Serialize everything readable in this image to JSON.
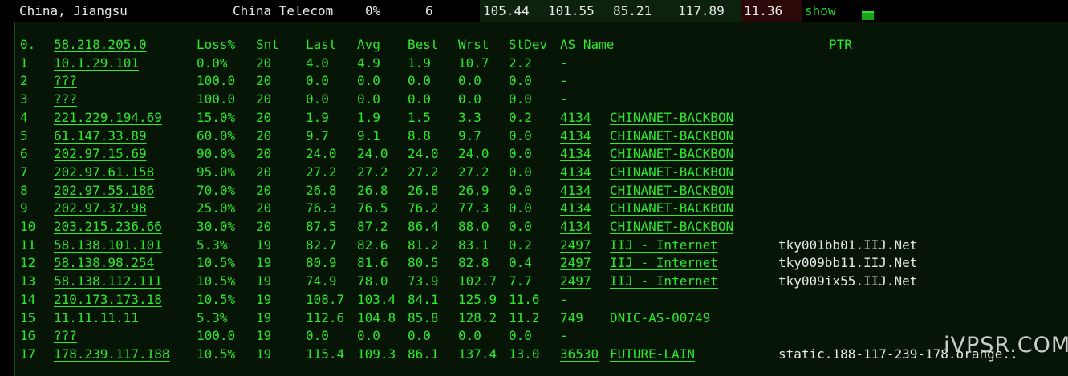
{
  "top": {
    "location": "China, Jiangsu",
    "isp": "China Telecom",
    "loss": "0%",
    "count": "6",
    "v1": "105.44",
    "v2": "101.55",
    "v3": "85.21",
    "v4": "117.89",
    "v5": "11.36",
    "show_label": "show"
  },
  "table": {
    "header": {
      "idx": "0.",
      "ip": "58.218.205.0",
      "loss": "Loss%",
      "snt": "Snt",
      "last": "Last",
      "avg": "Avg",
      "best": "Best",
      "wrst": "Wrst",
      "stdev": "StDev",
      "as": "AS Name",
      "ptr": "PTR"
    },
    "rows": [
      {
        "idx": "1",
        "ip": "10.1.29.101",
        "loss": "0.0%",
        "snt": "20",
        "last": "4.0",
        "avg": "4.9",
        "best": "1.9",
        "wrst": "10.7",
        "stdev": "2.2",
        "asn": "-",
        "asname": "",
        "ptr": ""
      },
      {
        "idx": "2",
        "ip": "???",
        "loss": "100.0",
        "snt": "20",
        "last": "0.0",
        "avg": "0.0",
        "best": "0.0",
        "wrst": "0.0",
        "stdev": "0.0",
        "asn": "-",
        "asname": "",
        "ptr": ""
      },
      {
        "idx": "3",
        "ip": "???",
        "loss": "100.0",
        "snt": "20",
        "last": "0.0",
        "avg": "0.0",
        "best": "0.0",
        "wrst": "0.0",
        "stdev": "0.0",
        "asn": "-",
        "asname": "",
        "ptr": ""
      },
      {
        "idx": "4",
        "ip": "221.229.194.69",
        "loss": "15.0%",
        "snt": "20",
        "last": "1.9",
        "avg": "1.9",
        "best": "1.5",
        "wrst": "3.3",
        "stdev": "0.2",
        "asn": "4134",
        "asname": "CHINANET-BACKBON",
        "ptr": ""
      },
      {
        "idx": "5",
        "ip": "61.147.33.89",
        "loss": "60.0%",
        "snt": "20",
        "last": "9.7",
        "avg": "9.1",
        "best": "8.8",
        "wrst": "9.7",
        "stdev": "0.0",
        "asn": "4134",
        "asname": "CHINANET-BACKBON",
        "ptr": ""
      },
      {
        "idx": "6",
        "ip": "202.97.15.69",
        "loss": "90.0%",
        "snt": "20",
        "last": "24.0",
        "avg": "24.0",
        "best": "24.0",
        "wrst": "24.0",
        "stdev": "0.0",
        "asn": "4134",
        "asname": "CHINANET-BACKBON",
        "ptr": ""
      },
      {
        "idx": "7",
        "ip": "202.97.61.158",
        "loss": "95.0%",
        "snt": "20",
        "last": "27.2",
        "avg": "27.2",
        "best": "27.2",
        "wrst": "27.2",
        "stdev": "0.0",
        "asn": "4134",
        "asname": "CHINANET-BACKBON",
        "ptr": ""
      },
      {
        "idx": "8",
        "ip": "202.97.55.186",
        "loss": "70.0%",
        "snt": "20",
        "last": "26.8",
        "avg": "26.8",
        "best": "26.8",
        "wrst": "26.9",
        "stdev": "0.0",
        "asn": "4134",
        "asname": "CHINANET-BACKBON",
        "ptr": ""
      },
      {
        "idx": "9",
        "ip": "202.97.37.98",
        "loss": "25.0%",
        "snt": "20",
        "last": "76.3",
        "avg": "76.5",
        "best": "76.2",
        "wrst": "77.3",
        "stdev": "0.0",
        "asn": "4134",
        "asname": "CHINANET-BACKBON",
        "ptr": ""
      },
      {
        "idx": "10",
        "ip": "203.215.236.66",
        "loss": "30.0%",
        "snt": "20",
        "last": "87.5",
        "avg": "87.2",
        "best": "86.4",
        "wrst": "88.0",
        "stdev": "0.0",
        "asn": "4134",
        "asname": "CHINANET-BACKBON",
        "ptr": ""
      },
      {
        "idx": "11",
        "ip": "58.138.101.101",
        "loss": "5.3%",
        "snt": "19",
        "last": "82.7",
        "avg": "82.6",
        "best": "81.2",
        "wrst": "83.1",
        "stdev": "0.2",
        "asn": "2497",
        "asname": "IIJ - Internet",
        "ptr": "tky001bb01.IIJ.Net"
      },
      {
        "idx": "12",
        "ip": "58.138.98.254",
        "loss": "10.5%",
        "snt": "19",
        "last": "80.9",
        "avg": "81.6",
        "best": "80.5",
        "wrst": "82.8",
        "stdev": "0.4",
        "asn": "2497",
        "asname": "IIJ - Internet",
        "ptr": "tky009bb11.IIJ.Net"
      },
      {
        "idx": "13",
        "ip": "58.138.112.111",
        "loss": "10.5%",
        "snt": "19",
        "last": "74.9",
        "avg": "78.0",
        "best": "73.9",
        "wrst": "102.7",
        "stdev": "7.7",
        "asn": "2497",
        "asname": "IIJ - Internet",
        "ptr": "tky009ix55.IIJ.Net"
      },
      {
        "idx": "14",
        "ip": "210.173.173.18",
        "loss": "10.5%",
        "snt": "19",
        "last": "108.7",
        "avg": "103.4",
        "best": "84.1",
        "wrst": "125.9",
        "stdev": "11.6",
        "asn": "-",
        "asname": "",
        "ptr": ""
      },
      {
        "idx": "15",
        "ip": "11.11.11.11",
        "loss": "5.3%",
        "snt": "19",
        "last": "112.6",
        "avg": "104.8",
        "best": "85.8",
        "wrst": "128.2",
        "stdev": "11.2",
        "asn": "749",
        "asname": "DNIC-AS-00749",
        "ptr": ""
      },
      {
        "idx": "16",
        "ip": "???",
        "loss": "100.0",
        "snt": "19",
        "last": "0.0",
        "avg": "0.0",
        "best": "0.0",
        "wrst": "0.0",
        "stdev": "0.0",
        "asn": "-",
        "asname": "",
        "ptr": ""
      },
      {
        "idx": "17",
        "ip": "178.239.117.188",
        "loss": "10.5%",
        "snt": "19",
        "last": "115.4",
        "avg": "109.3",
        "best": "86.1",
        "wrst": "137.4",
        "stdev": "13.0",
        "asn": "36530",
        "asname": "FUTURE-LAIN",
        "ptr": "static.188-117-239-178.orange.."
      }
    ]
  },
  "watermark": "iVPSR.COM"
}
